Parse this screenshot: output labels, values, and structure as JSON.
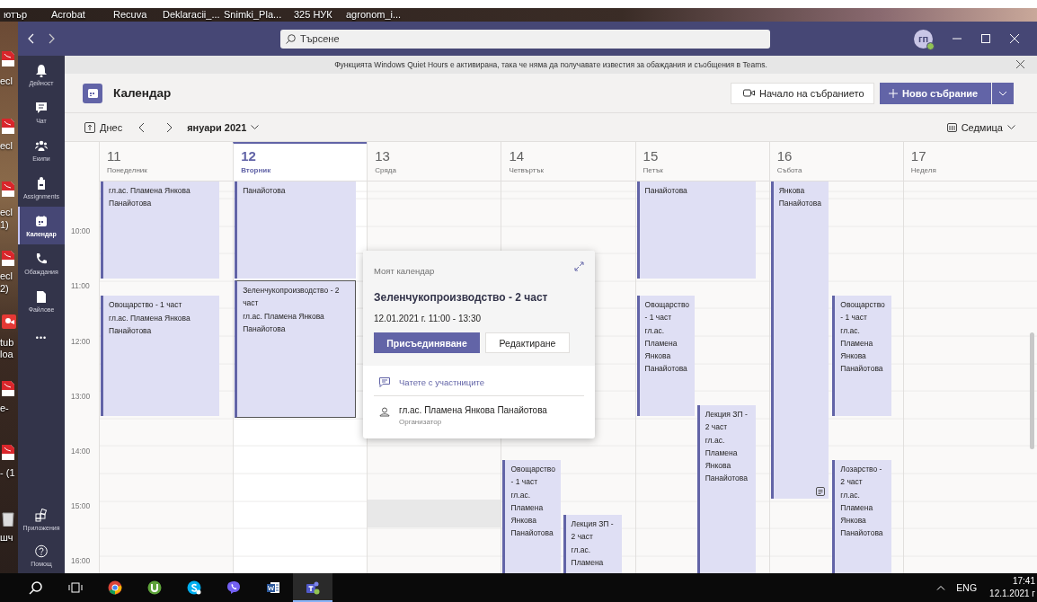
{
  "desktop": {
    "labels": [
      "ютър",
      "Acrobat",
      "Recuva",
      "Deklaracii_...",
      "Snimki_Pla...",
      "325 НУК",
      "agronom_i..."
    ],
    "side_labels": [
      "ecl",
      "ecl",
      "ecl",
      "1)",
      "ecl",
      "2)",
      "tub",
      "loa",
      "e-",
      "- (1",
      "шч"
    ]
  },
  "title_bar": {
    "search": {
      "placeholder": "Търсене"
    },
    "avatar": {
      "initials": "гп"
    }
  },
  "rail": {
    "items": [
      {
        "label": "Дейност",
        "selected": false
      },
      {
        "label": "Чат",
        "selected": false
      },
      {
        "label": "Екипи",
        "selected": false
      },
      {
        "label": "Assignments",
        "selected": false
      },
      {
        "label": "Календар",
        "selected": true
      },
      {
        "label": "Обаждания",
        "selected": false
      },
      {
        "label": "Файлове",
        "selected": false
      }
    ],
    "more": "•••",
    "bottom_items": [
      {
        "label": "Приложения"
      },
      {
        "label": "Помощ"
      }
    ]
  },
  "notification": "Функцията Windows Quiet Hours е активирана, така че няма да получавате известия за обаждания и съобщения в Teams.",
  "header": {
    "title": "Календар",
    "meet_now": "Начало на събранието",
    "new_meeting": "Ново събрание"
  },
  "toolbar": {
    "today": "Днес",
    "month": "януари 2021",
    "view": "Седмица"
  },
  "days": [
    {
      "number": "11",
      "name": "Понеделник",
      "current": false
    },
    {
      "number": "12",
      "name": "Вторник",
      "current": true
    },
    {
      "number": "13",
      "name": "Сряда",
      "current": false
    },
    {
      "number": "14",
      "name": "Четвъртък",
      "current": false
    },
    {
      "number": "15",
      "name": "Петък",
      "current": false
    },
    {
      "number": "16",
      "name": "Събота",
      "current": false
    },
    {
      "number": "17",
      "name": "Неделя",
      "current": false
    }
  ],
  "times": [
    "10:00",
    "11:00",
    "12:00",
    "13:00",
    "14:00",
    "15:00",
    "16:00"
  ],
  "events": [
    {
      "organizer": "гл.ас. Пламена Янкова Панайотова",
      "selected": false,
      "has_notes": false
    },
    {
      "title": "Овощарство - 1 част",
      "organizer": "гл.ас. Пламена Янкова Панайотова",
      "selected": false,
      "has_notes": false
    },
    {
      "organizer": "Панайотова",
      "selected": false,
      "has_notes": false
    },
    {
      "title": "Зеленчукопроизводство - 2 част",
      "organizer": "гл.ас. Пламена Янкова Панайотова",
      "selected": true,
      "has_notes": false
    },
    {
      "title": "Овощарство - 1 част",
      "organizer": "гл.ас. Пламена Янкова Панайотова",
      "selected": false,
      "has_notes": false
    },
    {
      "title": "Лекция ЗП - 2 част",
      "organizer": "гл.ас. Пламена",
      "selected": false,
      "has_notes": false
    },
    {
      "organizer": "Панайотова",
      "selected": false,
      "has_notes": false
    },
    {
      "title": "Овощарство - 1 част",
      "organizer": "гл.ас. Пламена Янкова Панайотова",
      "selected": false,
      "has_notes": false
    },
    {
      "title": "Лекция ЗП - 2 част",
      "organizer": "гл.ас. Пламена Янкова Панайотова",
      "selected": false,
      "has_notes": false
    },
    {
      "organizer": "Янкова Панайотова",
      "selected": false,
      "has_notes": true
    },
    {
      "title": "Овощарство - 1 част",
      "organizer": "гл.ас. Пламена Янкова Панайотова",
      "selected": false,
      "has_notes": false
    },
    {
      "title": "Лозарство - 2 част",
      "organizer": "гл.ас. Пламена Янкова Панайотова",
      "selected": false,
      "has_notes": false
    }
  ],
  "popup": {
    "calendar": "Моят календар",
    "title": "Зеленчукопроизводство - 2 част",
    "when": "12.01.2021 г. 11:00 - 13:30",
    "buttons": [
      {
        "label": "Присъединяване",
        "primary": true
      },
      {
        "label": "Редактиране",
        "primary": false
      }
    ],
    "chat_link": "Чатете с участниците",
    "organizer": {
      "name": "гл.ас. Пламена Янкова Панайотова",
      "role": "Организатор"
    }
  },
  "taskbar": {
    "language": "ENG",
    "time": "17:41",
    "date": "12.1.2021 г"
  }
}
